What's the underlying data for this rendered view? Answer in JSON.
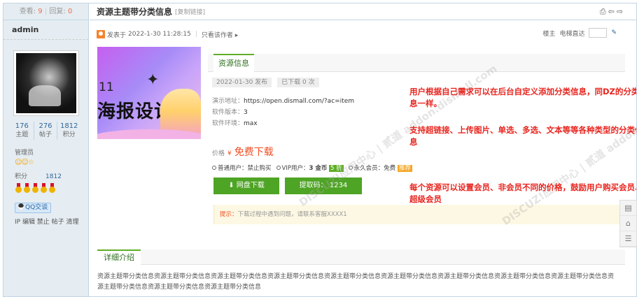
{
  "sidebar": {
    "views_label": "查看:",
    "views": "9",
    "replies_label": "回复:",
    "replies": "0",
    "username": "admin",
    "stats": [
      {
        "num": "176",
        "label": "主题"
      },
      {
        "num": "276",
        "label": "帖子"
      },
      {
        "num": "1812",
        "label": "积分"
      }
    ],
    "group": "管理员",
    "stars": "☺☺☆",
    "points_label": "积分",
    "points": "1812",
    "qq_label": "QQ交谈",
    "ip_links": "IP 编辑 禁止 帖子 清理"
  },
  "thread": {
    "title": "资源主题带分类信息",
    "copy_link": "[复制链接]",
    "tools": "⎙⇦⇨",
    "posted_prefix": "发表于",
    "posted_time": "2022-1-30 11:28:15",
    "author_only": "只看该作者 ▸",
    "floor_label": "楼主",
    "jump_label": "电梯直达"
  },
  "banner": {
    "line1": "11",
    "line2": "海报设计"
  },
  "resource": {
    "tab_label": "资源信息",
    "date_badge": "2022-01-30 发布",
    "downloads_badge": "已下载 0 次",
    "demo_label": "演示地址：",
    "demo_url": "https://open.dismall.com/?ac=item",
    "version_label": "软件版本：",
    "version": "3",
    "env_label": "软件环境：",
    "env": "max",
    "price_label": "价格",
    "price_symbol": "¥",
    "price_value": "免费下载",
    "opt_normal": "普通用户：禁止购买",
    "opt_vip_prefix": "VIP用户：",
    "opt_vip_value": "3 金币",
    "opt_vip_discount": "5 折",
    "opt_perm": "永久会员：免费",
    "opt_perm_badge": "推荐",
    "btn_download": "⬇ 网盘下载",
    "btn_code": "提取码： 1234",
    "tip_label": "提示：",
    "tip_text": "下载过程中遇到问题，请联系客服XXXX1"
  },
  "annotations": {
    "a1": "用户根据自己需求可以在后台自定义添加分类信息，同DZ的分类信息一样。",
    "a2": "支持超链接、上传图片、单选、多选、文本等等各种类型的分类信息",
    "a3": "每个资源可以设置会员、非会员不同的价格，鼓励用户购买会员、超级会员"
  },
  "watermark": "DISCUZ!应用中心 | 贰道 addon.dismall.com",
  "detail": {
    "tab_label": "详细介绍",
    "text": "资源主题带分类信息资源主题带分类信息资源主题带分类信息资源主题带分类信息资源主题带分类信息资源主题带分类信息资源主题带分类信息资源主题带分类信息资源主题带分类信息资源主题带分类信息资源主题带分类信息资源主题带分类信息"
  },
  "float_tools": [
    "▤",
    "⌂",
    "☰"
  ]
}
